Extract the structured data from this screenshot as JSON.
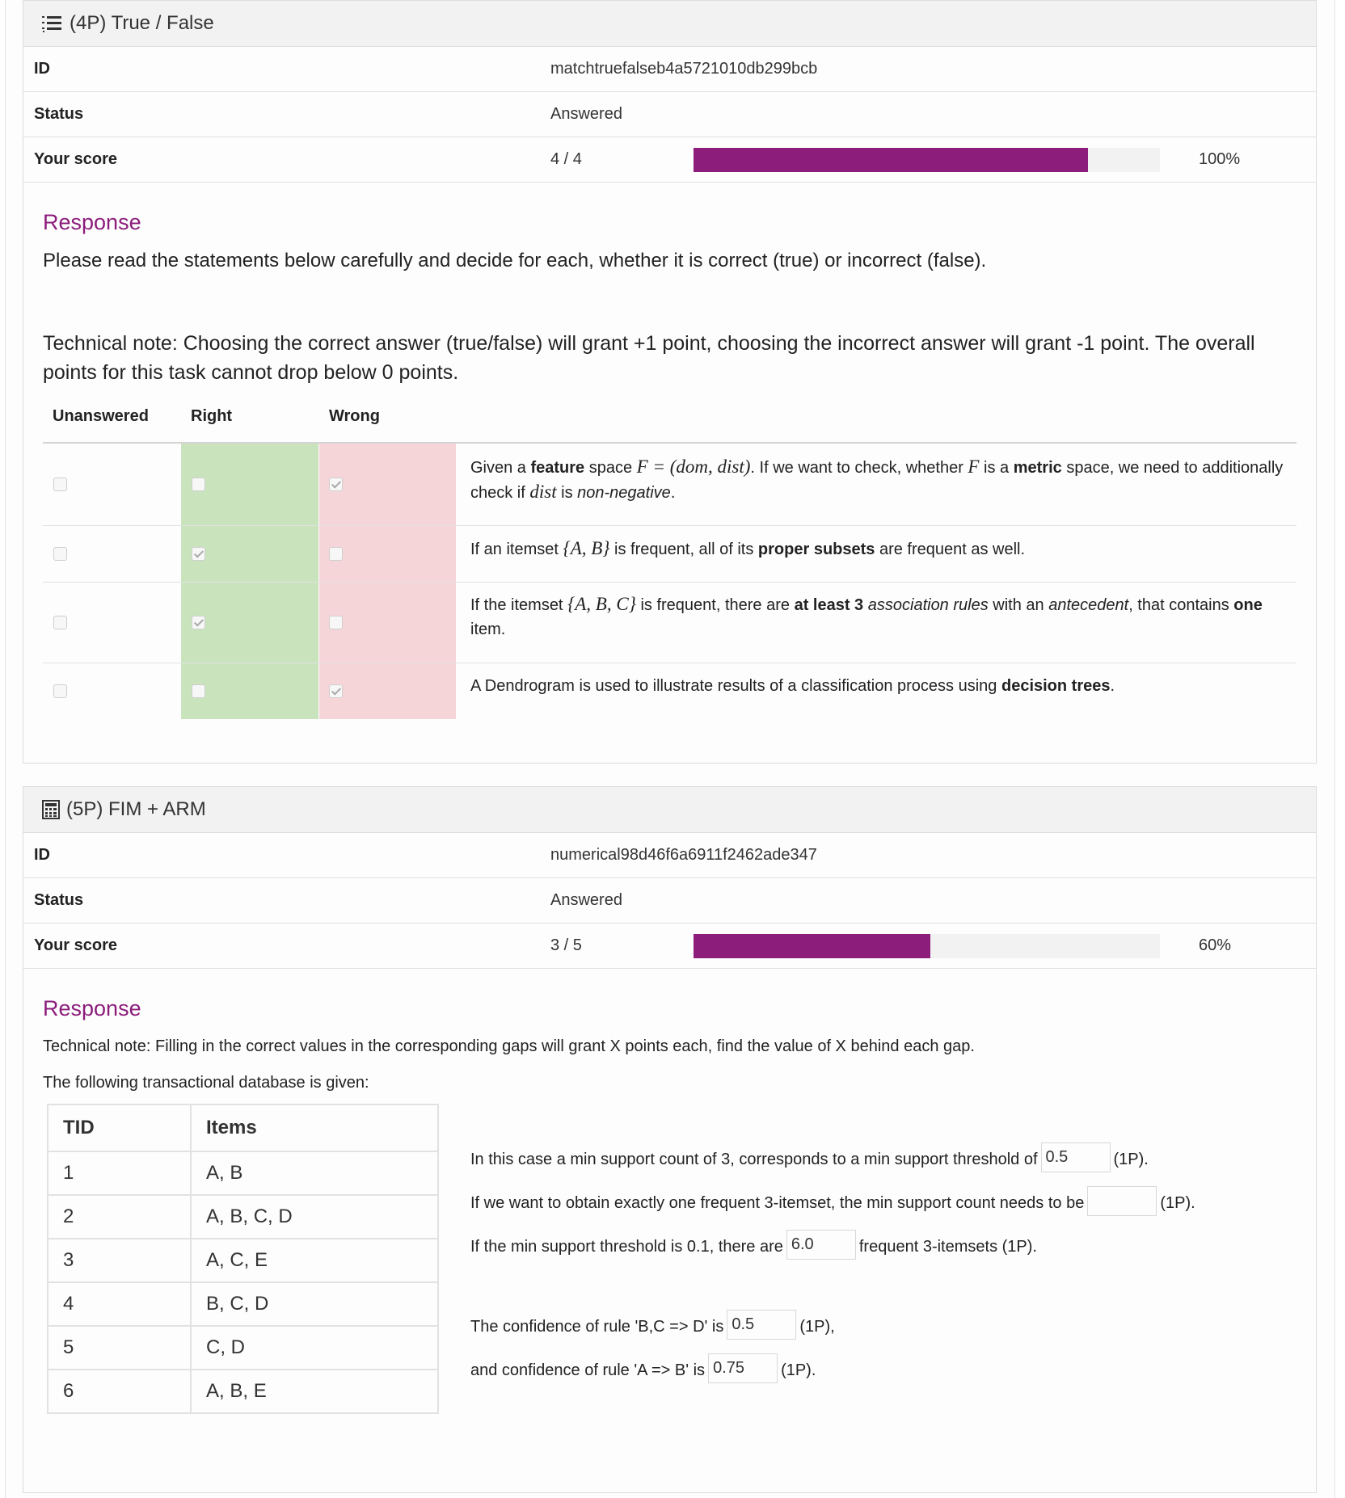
{
  "task1": {
    "title": "(4P) True / False",
    "icon": "list-ordered-icon",
    "id_label": "ID",
    "id_value": "matchtruefalseb4a5721010db299bcb",
    "status_label": "Status",
    "status_value": "Answered",
    "score_label": "Your score",
    "score_value": "4 / 4",
    "score_fraction": 1.0,
    "score_percent": "100%",
    "response_title": "Response",
    "intro": "Please read the statements below carefully and decide for each, whether it is correct (true) or incorrect (false).",
    "tech_note": "Technical note: Choosing the correct answer (true/false) will grant +1 point, choosing the incorrect answer will grant -1 point. The overall points for this task cannot drop below 0 points.",
    "columns": [
      "Unanswered",
      "Right",
      "Wrong"
    ],
    "statements": [
      {
        "unanswered": false,
        "right": false,
        "wrong": true
      },
      {
        "unanswered": false,
        "right": true,
        "wrong": false
      },
      {
        "unanswered": false,
        "right": true,
        "wrong": false
      },
      {
        "unanswered": false,
        "right": false,
        "wrong": true
      }
    ],
    "stmt1": {
      "a": "Given a ",
      "b": "feature",
      "c": " space ",
      "m1": "F = (dom, dist)",
      "d": ". If we want to check, whether ",
      "m2": "F",
      "e": " is a ",
      "f": "metric",
      "g": " space, we need to additionally check if ",
      "m3": "dist",
      "h": " is ",
      "i": "non-negative",
      "j": "."
    },
    "stmt2": {
      "a": "If an itemset ",
      "m1": "{A, B}",
      "b": " is frequent, all of its ",
      "c": "proper subsets",
      "d": " are frequent as well."
    },
    "stmt3": {
      "a": "If the itemset ",
      "m1": "{A, B, C}",
      "b": " is frequent, there are ",
      "c": "at least 3",
      "d": " ",
      "e": "association rules",
      "f": " with an ",
      "g": "antecedent",
      "h": ", that contains ",
      "i": "one",
      "j": " item."
    },
    "stmt4": {
      "a": "A Dendrogram is used to illustrate results of a classification process using ",
      "b": "decision trees",
      "c": "."
    }
  },
  "task2": {
    "title": "(5P) FIM + ARM",
    "icon": "calculator-icon",
    "id_label": "ID",
    "id_value": "numerical98d46f6a6911f2462ade347",
    "status_label": "Status",
    "status_value": "Answered",
    "score_label": "Your score",
    "score_value": "3 / 5",
    "score_fraction": 0.6,
    "score_percent": "60%",
    "response_title": "Response",
    "tech_note": "Technical note: Filling in the correct values in the corresponding gaps will grant X points each, find the value of X behind each gap.",
    "db_intro": "The following transactional database is given:",
    "table_headers": [
      "TID",
      "Items"
    ],
    "table_rows": [
      [
        "1",
        "A, B"
      ],
      [
        "2",
        "A, B, C, D"
      ],
      [
        "3",
        "A, C, E"
      ],
      [
        "4",
        "B, C, D"
      ],
      [
        "5",
        "C, D"
      ],
      [
        "6",
        "A, B, E"
      ]
    ],
    "gap1": {
      "before": "In this case a min support count of 3, corresponds to a min support threshold of",
      "value": "0.5",
      "after": "(1P)."
    },
    "gap2": {
      "before": "If we want to obtain exactly one frequent 3-itemset, the min support count needs to be",
      "value": "",
      "after": "(1P)."
    },
    "gap3": {
      "before": "If the min support threshold is 0.1, there are",
      "value": "6.0",
      "after": "frequent 3-itemsets (1P)."
    },
    "gap4": {
      "before": "The confidence of rule 'B,C => D' is",
      "value": "0.5",
      "after": "(1P),"
    },
    "gap5": {
      "before": "and confidence of rule 'A => B' is",
      "value": "0.75",
      "after": "(1P)."
    }
  },
  "colors": {
    "accent": "#8c1d7b",
    "right_bg": "#c9e3bd",
    "wrong_bg": "#f6d5d8"
  }
}
